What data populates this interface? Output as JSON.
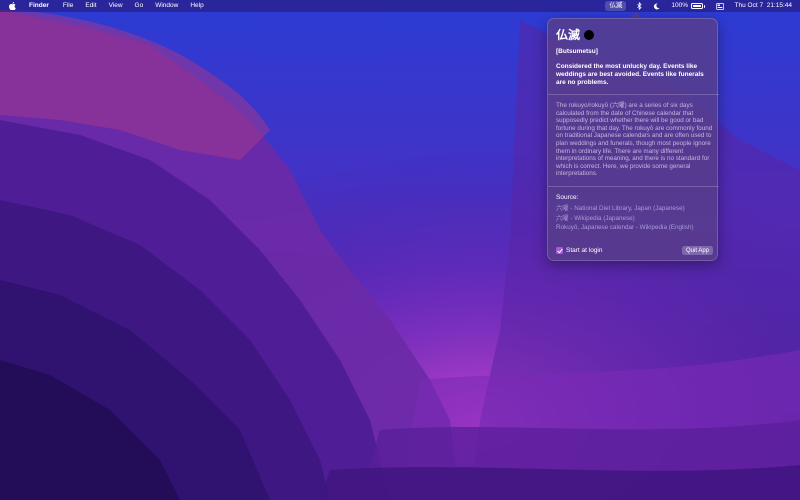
{
  "menubar": {
    "app_name": "Finder",
    "menus": [
      "File",
      "Edit",
      "View",
      "Go",
      "Window",
      "Help"
    ],
    "status_kanji": "仏滅",
    "battery_percent_label": "100%",
    "battery_level": 1.0,
    "datetime": "Thu Oct 7  21:15:44"
  },
  "popover": {
    "title": "仏滅",
    "romaji": "[Butsumetsu]",
    "summary": "Considered the most unlucky day. Events like weddings are best avoided. Events like funerals are no problems.",
    "description": "The rokuyo/rokuyō (六曜) are a series of six days calculated from the date of Chinese calendar that supposedly predict whether there will be good or bad fortune during that day. The rokuyō are commonly found on traditional Japanese calendars and are often used to plan weddings and funerals, though most people ignore them in ordinary life. There are many different interpretations of meaning, and there is no standard for which is correct. Here, we provide some general interpretations.",
    "source_title": "Source:",
    "links": [
      "六曜 - National Diet Library, Japan (Japanese)",
      "六曜 - Wikipedia (Japanese)",
      "Rokuyō, Japanese calendar - Wikipedia (English)"
    ],
    "start_at_login_label": "Start at login",
    "start_at_login_checked": true,
    "quit_label": "Quit App"
  },
  "colors": {
    "accent": "#a659d8",
    "wallpaper_top": "#2f3fd0",
    "wallpaper_mid": "#6a2bb0",
    "wallpaper_bottom": "#24104f"
  },
  "icons": [
    "apple-icon",
    "bluetooth-icon",
    "moon-icon",
    "battery-icon",
    "control-center-icon",
    "checkmark-icon"
  ]
}
